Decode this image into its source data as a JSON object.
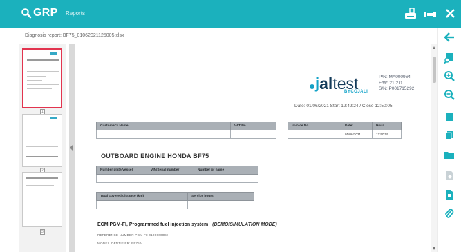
{
  "app": {
    "logo": "GRP",
    "section": "Reports",
    "brand_color": "#1bb1bd",
    "accent_color": "#13a3c8"
  },
  "toolbar_top": {
    "icons": [
      "printer-icon",
      "truck-icon",
      "close-icon"
    ]
  },
  "document": {
    "title": "Diagnosis report: BF75_01062021125005.xlsx"
  },
  "thumbnails": {
    "pages": [
      "1",
      "2",
      "3"
    ],
    "active_page": "1"
  },
  "report": {
    "brand": {
      "prefix": "j",
      "word_bold": "al",
      "word_rest": "test",
      "by": "BYCOJALI"
    },
    "ids": {
      "pn": "P/N: MA000964",
      "fw": "F/W: 21.2.0",
      "sn": "S/N: P001715292"
    },
    "date_line": "Date: 01/06/2021   Start 12:49:24 / Close 12:50:05",
    "customer_table": {
      "headers": [
        "Customer's Name",
        "VAT No."
      ],
      "values": [
        "",
        ""
      ]
    },
    "invoice_table": {
      "headers": [
        "Invoice No.",
        "Date:",
        "Hour"
      ],
      "values": [
        "",
        "01/06/2021",
        "12:50:05"
      ]
    },
    "engine_title": "OUTBOARD ENGINE  HONDA  BF75",
    "vessel_table": {
      "headers": [
        "Number plate/Vessel",
        "VIN/Serial number",
        "Number or name"
      ],
      "values": [
        "",
        "",
        ""
      ]
    },
    "distance_table": {
      "headers": [
        "Total covered distance (km)",
        "Service hours"
      ],
      "values": [
        "",
        ""
      ]
    },
    "ecm_title": "ECM PGM-FI, Programmed fuel injection system",
    "ecm_mode": "(DEMO/SIMULATION MODE)",
    "reference": "REFERENCE NUMBER PGM-FI: 0100000003",
    "model": "MODEL IDENTIFIER: BF75A"
  },
  "toolbar_right": {
    "icons": [
      "back-arrow-icon",
      "document-search-icon",
      "zoom-in-icon",
      "zoom-out-icon",
      "save-icon",
      "copy-icon",
      "folder-icon",
      "file-disabled-icon",
      "export-icon",
      "attachment-icon"
    ]
  }
}
